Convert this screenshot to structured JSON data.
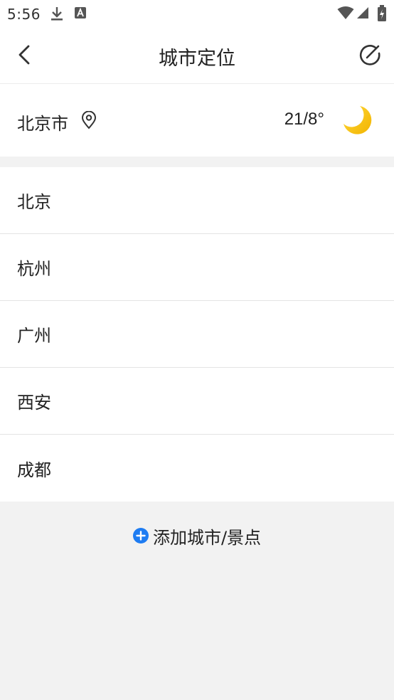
{
  "status_bar": {
    "time": "5:56",
    "icons": [
      "download-icon",
      "app-notification-icon",
      "wifi-icon",
      "signal-icon",
      "battery-icon"
    ]
  },
  "nav": {
    "title": "城市定位",
    "back_icon": "chevron-left-icon",
    "edit_icon": "edit-check-icon"
  },
  "current_location": {
    "city": "北京市",
    "temperature": "21/8°",
    "weather_icon": "moon-icon"
  },
  "cities": [
    {
      "name": "北京"
    },
    {
      "name": "杭州"
    },
    {
      "name": "广州"
    },
    {
      "name": "西安"
    },
    {
      "name": "成都"
    }
  ],
  "add_city": {
    "label": "添加城市/景点"
  },
  "colors": {
    "accent_blue": "#1e7cf2",
    "moon_yellow": "#f7c600",
    "background": "#f2f2f2"
  }
}
